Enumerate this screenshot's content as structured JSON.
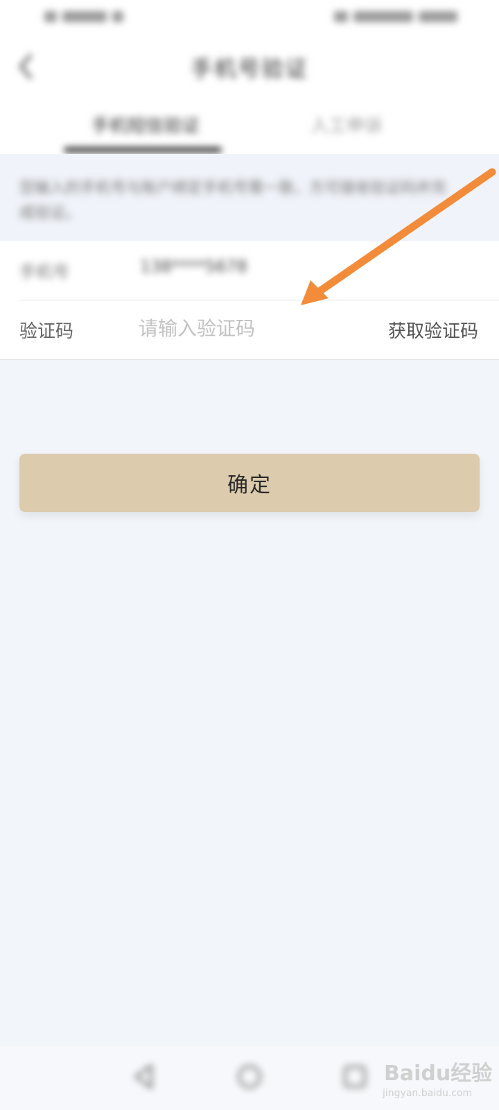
{
  "header": {
    "title": "手机号验证"
  },
  "tabs": [
    {
      "label": "手机短信验证"
    },
    {
      "label": "人工申诉"
    }
  ],
  "notice": {
    "text": "您输入的手机号与账户绑定手机号需一致，方可接收验证码并完成验证。"
  },
  "form": {
    "phone_label": "手机号",
    "phone_value": "138****5678",
    "code_label": "验证码",
    "code_placeholder": "请输入验证码",
    "code_value": "",
    "get_code_label": "获取验证码"
  },
  "confirm": {
    "label": "确定",
    "color": "#dccbad"
  },
  "annotation": {
    "color": "#f28c3a"
  },
  "watermark": {
    "brand": "Baidu经验",
    "url": "jingyan.baidu.com"
  }
}
